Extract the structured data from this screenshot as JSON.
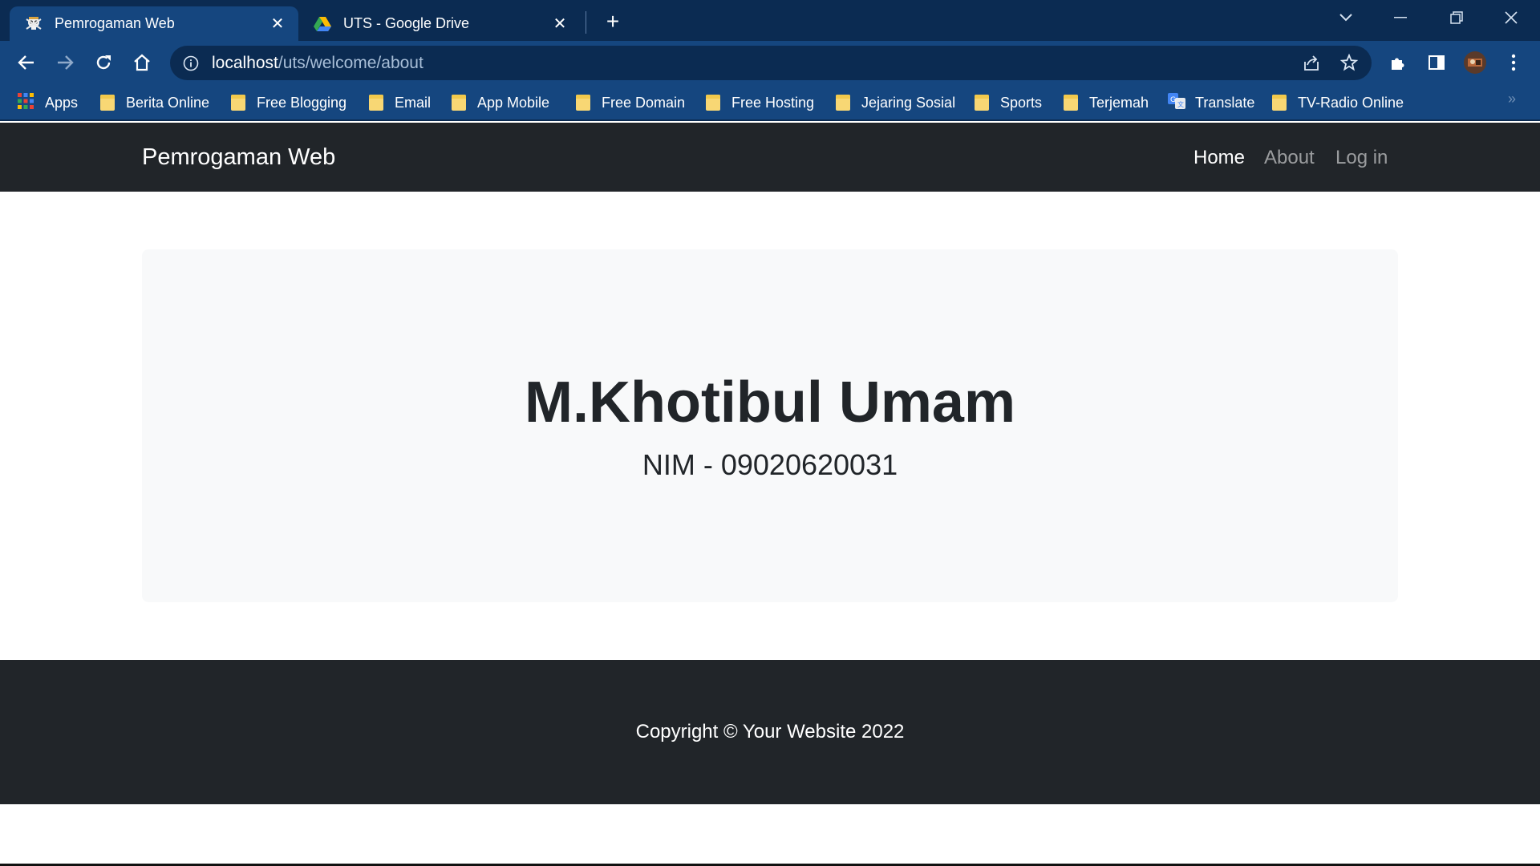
{
  "browser": {
    "tabs": [
      {
        "title": "Pemrogaman Web",
        "favicon": "skull-icon",
        "active": true
      },
      {
        "title": "UTS - Google Drive",
        "favicon": "google-drive-icon",
        "active": false
      }
    ],
    "address": {
      "host": "localhost",
      "path": "/uts/welcome/about"
    },
    "bookmarks": [
      {
        "label": "Apps",
        "icon": "apps-grid-icon"
      },
      {
        "label": "Berita Online",
        "icon": "folder-icon"
      },
      {
        "label": "Free Blogging",
        "icon": "folder-icon"
      },
      {
        "label": "Email",
        "icon": "folder-icon"
      },
      {
        "label": "App Mobile",
        "icon": "folder-icon"
      },
      {
        "label": "Free Domain",
        "icon": "folder-icon"
      },
      {
        "label": "Free Hosting",
        "icon": "folder-icon"
      },
      {
        "label": "Jejaring Sosial",
        "icon": "folder-icon"
      },
      {
        "label": "Sports",
        "icon": "folder-icon"
      },
      {
        "label": "Terjemah",
        "icon": "folder-icon"
      },
      {
        "label": "Translate",
        "icon": "google-translate-icon"
      },
      {
        "label": "TV-Radio Online",
        "icon": "folder-icon"
      }
    ],
    "more_bookmarks": "»"
  },
  "site": {
    "brand": "Pemrogaman Web",
    "nav": [
      {
        "label": "Home",
        "active": true
      },
      {
        "label": "About",
        "active": false
      },
      {
        "label": "Log in",
        "active": false
      }
    ],
    "hero": {
      "title": "M.Khotibul Umam",
      "subtitle": "NIM - 09020620031"
    },
    "footer": "Copyright © Your Website 2022"
  },
  "colors": {
    "titlebar": "#0b2b52",
    "toolbar": "#15467f",
    "navbar": "#212529",
    "jumbotron": "#f8f9fa"
  }
}
